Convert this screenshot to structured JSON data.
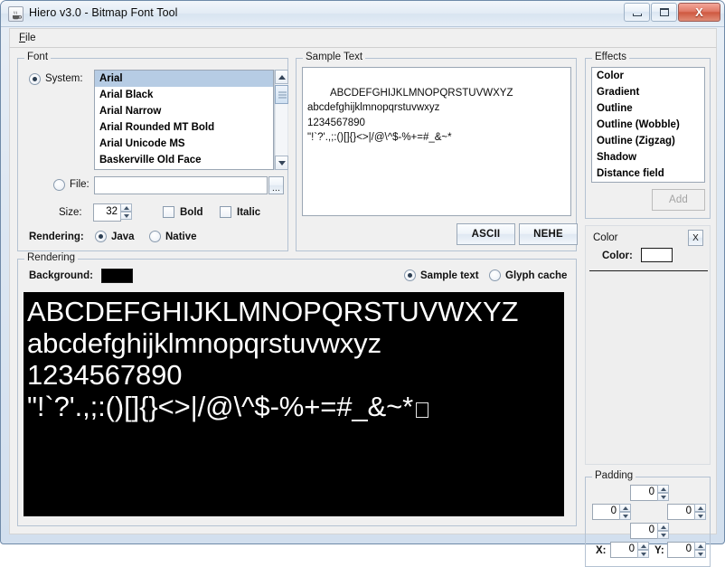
{
  "window": {
    "title": "Hiero v3.0 - Bitmap Font Tool",
    "icon": "java-coffee-cup-icon",
    "controls": {
      "minimize": "minimize-icon",
      "maximize": "maximize-icon",
      "close": "X"
    }
  },
  "menubar": {
    "items": [
      {
        "label": "File",
        "mnemonic": "F"
      }
    ]
  },
  "font_panel": {
    "title": "Font",
    "system_label": "System:",
    "system_selected": true,
    "font_list": [
      "Arial",
      "Arial Black",
      "Arial Narrow",
      "Arial Rounded MT Bold",
      "Arial Unicode MS",
      "Baskerville Old Face"
    ],
    "font_selected_index": 0,
    "file_label": "File:",
    "file_selected": false,
    "file_value": "",
    "file_browse_label": "...",
    "size_label": "Size:",
    "size_value": "32",
    "bold_label": "Bold",
    "bold_checked": false,
    "italic_label": "Italic",
    "italic_checked": false,
    "rendering_label": "Rendering:",
    "rendering_java_label": "Java",
    "rendering_native_label": "Native",
    "rendering_selected": "Java"
  },
  "sample_panel": {
    "title": "Sample Text",
    "lines": [
      "ABCDEFGHIJKLMNOPQRSTUVWXYZ",
      "abcdefghijklmnopqrstuvwxyz",
      "1234567890",
      "\"!`?'.,;:()[]{}<>|/@\\^$-%+=#_&~*"
    ],
    "ascii_button": "ASCII",
    "nehe_button": "NEHE"
  },
  "effects_panel": {
    "title": "Effects",
    "items": [
      "Color",
      "Gradient",
      "Outline",
      "Outline (Wobble)",
      "Outline (Zigzag)",
      "Shadow",
      "Distance field"
    ],
    "selected_index": -1,
    "add_button": "Add",
    "add_enabled": false
  },
  "effect_config": {
    "title": "Color",
    "close_label": "X",
    "color_label": "Color:",
    "color_value": "#ffffff"
  },
  "padding_panel": {
    "title": "Padding",
    "top": "0",
    "left": "0",
    "right": "0",
    "bottom": "0",
    "x_label": "X:",
    "x_value": "0",
    "y_label": "Y:",
    "y_value": "0"
  },
  "rendering_panel": {
    "title": "Rendering",
    "background_label": "Background:",
    "background_color": "#000000",
    "sample_text_label": "Sample text",
    "glyph_cache_label": "Glyph cache",
    "view_selected": "Sample text",
    "preview_lines": [
      "ABCDEFGHIJKLMNOPQRSTUVWXYZ",
      "abcdefghijklmnopqrstuvwxyz",
      "1234567890",
      "\"!`?'.,;:()[]{}<>|/@\\^$-%+=#_&~*"
    ],
    "preview_text_color": "#ffffff"
  }
}
